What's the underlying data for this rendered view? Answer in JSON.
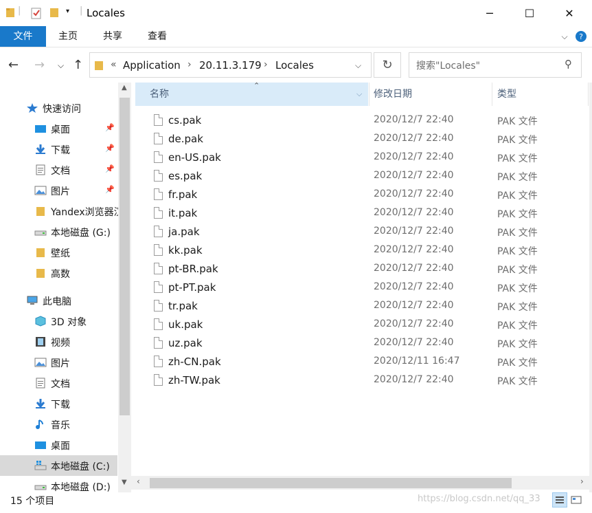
{
  "window": {
    "title": "Locales",
    "minimize_icon": "minimize-icon",
    "maximize_icon": "maximize-icon",
    "close_icon": "close-icon"
  },
  "ribbon": {
    "tabs": [
      "文件",
      "主页",
      "共享",
      "查看"
    ],
    "accent": "#1979ca"
  },
  "address": {
    "overflow": "«",
    "crumbs": [
      "Application",
      "20.11.3.179",
      "Locales"
    ],
    "search_placeholder": "搜索\"Locales\""
  },
  "nav": {
    "items": [
      {
        "label": "快速访问",
        "icon": "star-icon"
      },
      {
        "label": "桌面",
        "icon": "desktop-icon",
        "pinned": true
      },
      {
        "label": "下载",
        "icon": "download-icon",
        "pinned": true
      },
      {
        "label": "文档",
        "icon": "document-icon",
        "pinned": true
      },
      {
        "label": "图片",
        "icon": "picture-icon",
        "pinned": true
      },
      {
        "label": "Yandex浏览器汉",
        "icon": "folder-icon"
      },
      {
        "label": "本地磁盘 (G:)",
        "icon": "drive-icon"
      },
      {
        "label": "壁纸",
        "icon": "folder-icon"
      },
      {
        "label": "高数",
        "icon": "folder-icon"
      },
      {
        "label": "此电脑",
        "icon": "computer-icon"
      },
      {
        "label": "3D 对象",
        "icon": "cube-icon"
      },
      {
        "label": "视频",
        "icon": "video-icon"
      },
      {
        "label": "图片",
        "icon": "picture-icon"
      },
      {
        "label": "文档",
        "icon": "document-icon"
      },
      {
        "label": "下载",
        "icon": "download-icon"
      },
      {
        "label": "音乐",
        "icon": "music-icon"
      },
      {
        "label": "桌面",
        "icon": "desktop-icon"
      },
      {
        "label": "本地磁盘 (C:)",
        "icon": "windows-drive-icon",
        "selected": true
      },
      {
        "label": "本地磁盘 (D:)",
        "icon": "drive-icon"
      }
    ]
  },
  "columns": {
    "name": "名称",
    "date": "修改日期",
    "type": "类型"
  },
  "files": [
    {
      "name": "cs.pak",
      "date": "2020/12/7 22:40",
      "type": "PAK 文件"
    },
    {
      "name": "de.pak",
      "date": "2020/12/7 22:40",
      "type": "PAK 文件"
    },
    {
      "name": "en-US.pak",
      "date": "2020/12/7 22:40",
      "type": "PAK 文件"
    },
    {
      "name": "es.pak",
      "date": "2020/12/7 22:40",
      "type": "PAK 文件"
    },
    {
      "name": "fr.pak",
      "date": "2020/12/7 22:40",
      "type": "PAK 文件"
    },
    {
      "name": "it.pak",
      "date": "2020/12/7 22:40",
      "type": "PAK 文件"
    },
    {
      "name": "ja.pak",
      "date": "2020/12/7 22:40",
      "type": "PAK 文件"
    },
    {
      "name": "kk.pak",
      "date": "2020/12/7 22:40",
      "type": "PAK 文件"
    },
    {
      "name": "pt-BR.pak",
      "date": "2020/12/7 22:40",
      "type": "PAK 文件"
    },
    {
      "name": "pt-PT.pak",
      "date": "2020/12/7 22:40",
      "type": "PAK 文件"
    },
    {
      "name": "tr.pak",
      "date": "2020/12/7 22:40",
      "type": "PAK 文件"
    },
    {
      "name": "uk.pak",
      "date": "2020/12/7 22:40",
      "type": "PAK 文件"
    },
    {
      "name": "uz.pak",
      "date": "2020/12/7 22:40",
      "type": "PAK 文件"
    },
    {
      "name": "zh-CN.pak",
      "date": "2020/12/11 16:47",
      "type": "PAK 文件"
    },
    {
      "name": "zh-TW.pak",
      "date": "2020/12/7 22:40",
      "type": "PAK 文件"
    }
  ],
  "status": {
    "count": "15 个项目",
    "watermark": "https://blog.csdn.net/qq_33"
  }
}
